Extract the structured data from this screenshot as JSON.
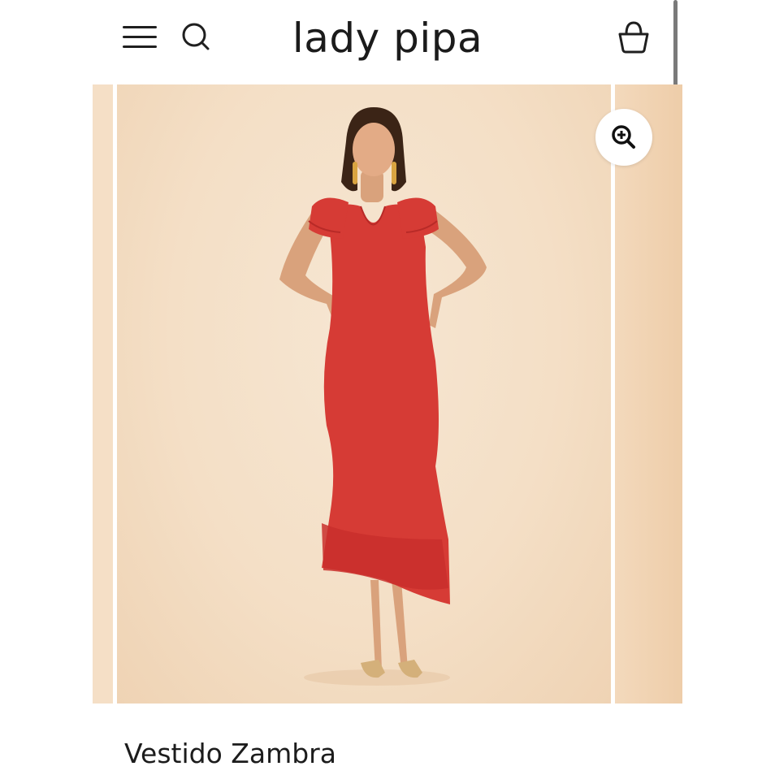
{
  "header": {
    "logo_text": "lady pipa",
    "menu_icon": "hamburger-menu-icon",
    "search_icon": "search-icon",
    "cart_icon": "basket-icon"
  },
  "gallery": {
    "zoom_icon": "zoom-in-icon",
    "product_image_alt": "Red midi dress with ruffled sleeves and tiered asymmetric hem",
    "background_color": "#f4dfc6",
    "dress_color": "#d63b35"
  },
  "product": {
    "title": "Vestido Zambra"
  }
}
